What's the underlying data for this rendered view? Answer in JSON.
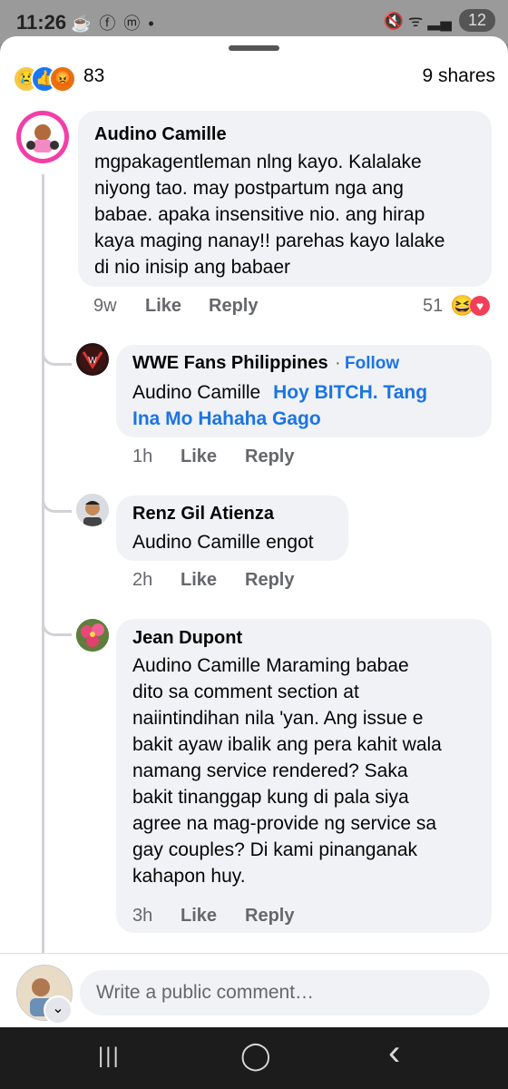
{
  "status_bar": {
    "time": "11:26",
    "left_icons": "☕ ⓕ ⓜ •",
    "right_icons": "🔇 ᯤ ▂▄",
    "battery": "12"
  },
  "summary": {
    "reaction_count": "83",
    "shares": "9 shares"
  },
  "comments": [
    {
      "author": "Audino Camille",
      "lines": [
        "mgpakagentleman nlng kayo. Kalalake",
        "niyong tao. may postpartum nga ang",
        "babae. apaka insensitive nio. ang hirap",
        "kaya maging nanay!! parehas kayo lalake",
        "di nio inisip ang babaer"
      ],
      "time": "9w",
      "like": "Like",
      "reply": "Reply",
      "reaction_count": "51"
    }
  ],
  "replies": [
    {
      "author": "WWE Fans Philippines",
      "follow_sep": "·",
      "follow": "Follow",
      "mention": "Audino Camille",
      "tag_line1": "Hoy BITCH. Tang",
      "tag_line2": "Ina Mo Hahaha Gago",
      "time": "1h",
      "like": "Like",
      "reply": "Reply"
    },
    {
      "author": "Renz Gil Atienza",
      "text": "Audino Camille engot",
      "time": "2h",
      "like": "Like",
      "reply": "Reply"
    },
    {
      "author": "Jean Dupont",
      "lines": [
        "Audino Camille Maraming babae",
        "dito sa comment section at",
        "naiintindihan nila 'yan. Ang issue e",
        "bakit ayaw ibalik ang pera kahit wala",
        "namang service rendered? Saka",
        "bakit tinanggap kung di pala siya",
        "agree na mag-provide ng service sa",
        "gay couples? Di kami pinanganak",
        "kahapon huy."
      ],
      "time": "3h",
      "like": "Like",
      "reply": "Reply"
    }
  ],
  "composer": {
    "placeholder": "Write a public comment…"
  },
  "nav": {
    "recents": "|||",
    "home": "◯",
    "back": "‹"
  },
  "colors": {
    "accent": "#1b74e4",
    "bubble": "#f0f2f5",
    "secondary_text": "#65676b"
  }
}
